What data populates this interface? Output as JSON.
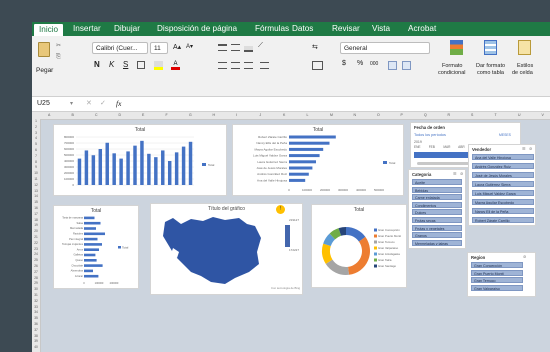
{
  "tabs": [
    "Inicio",
    "Insertar",
    "Dibujar",
    "Disposición de página",
    "Fórmulas",
    "Datos",
    "Revisar",
    "Vista",
    "Acrobat"
  ],
  "ribbon": {
    "paste_label": "Pegar",
    "font_name": "Calibri (Cuer...",
    "font_size": "11",
    "grow_font": "A▴",
    "shrink_font": "A▾",
    "bold": "N",
    "italic": "K",
    "underline": "S",
    "number_format": "General",
    "currency": "$",
    "percent": "%",
    "thousands": "000",
    "cond_format_1": "Formato",
    "cond_format_2": "condicional",
    "format_table_1": "Dar formato",
    "format_table_2": "como tabla",
    "cell_styles_1": "Estilos",
    "cell_styles_2": "de celda"
  },
  "formula_bar": {
    "name_box": "U25",
    "fx": "fx",
    "value": ""
  },
  "columns": [
    "A",
    "B",
    "C",
    "D",
    "E",
    "F",
    "G",
    "H",
    "I",
    "J",
    "K",
    "L",
    "M",
    "N",
    "O",
    "P",
    "Q",
    "R",
    "S",
    "T",
    "U",
    "V"
  ],
  "rows": [
    "1",
    "2",
    "3",
    "4",
    "5",
    "6",
    "7",
    "8",
    "9",
    "10",
    "11",
    "12",
    "13",
    "14",
    "15",
    "16",
    "17",
    "18",
    "19",
    "20",
    "21",
    "22",
    "23",
    "24",
    "25",
    "26",
    "27",
    "28",
    "29",
    "30",
    "31",
    "32",
    "33",
    "34",
    "35",
    "36",
    "37",
    "38",
    "39",
    "40"
  ],
  "chart1": {
    "title": "Total",
    "legend": "Total",
    "yticks": [
      "800000",
      "700000",
      "600000",
      "500000",
      "400000",
      "300000",
      "200000",
      "100000",
      "0"
    ],
    "values": [
      0.55,
      0.72,
      0.62,
      0.75,
      0.88,
      0.66,
      0.55,
      0.7,
      0.82,
      0.92,
      0.65,
      0.58,
      0.72,
      0.5,
      0.68,
      0.8,
      0.9
    ]
  },
  "chart2": {
    "title": "Total",
    "legend": "Total",
    "labels": [
      "Robert Zárate Carrillo",
      "Nancy Ellis del la Peña",
      "Mayra Aguilar Escobedo",
      "Luis Miguel Valdez Garza",
      "Laura Gutiérrez Sierra",
      "José de Jesús Morales",
      "Andrés González Ruiz",
      "Ana del Valle Hinojosa"
    ],
    "values": [
      0.52,
      0.45,
      0.38,
      0.34,
      0.3,
      0.26,
      0.22,
      0.18
    ],
    "xticks": [
      "0",
      "100000",
      "200000",
      "300000",
      "400000",
      "500000"
    ]
  },
  "slicer_fecha": {
    "title": "Fecha de orden",
    "sub": "Todos los períodos",
    "unit": "MESES",
    "year": "2019",
    "months": [
      "ENE",
      "FEB",
      "MAR",
      "ABR",
      "MAY",
      "JUN",
      "JUL"
    ]
  },
  "slicer_categoria": {
    "title": "Categoria",
    "items": [
      "Aceite",
      "Bebidas",
      "Carne enlatada",
      "Condimentos",
      "Dulces",
      "Frutas secas",
      "Frutas y vegetales",
      "Granos",
      "Mermeladas y jaleas"
    ]
  },
  "slicer_vendedor": {
    "title": "Vendedor",
    "items": [
      "Ana del Valle Hinojosa",
      "Andrés González Ruiz",
      "José de Jesús Morales",
      "Laura Gutiérrez Sierra",
      "Luis Miguel Valdez Garza",
      "Mayra Aguilar Escobedo",
      "Nancy Ell de la Peña",
      "Robert Zárate Carrillo"
    ]
  },
  "slicer_region": {
    "title": "Region",
    "items": [
      "Gran Concepción",
      "Gran Puerto Montt",
      "Gran Temuco",
      "Gran Valparaíso"
    ]
  },
  "chart3": {
    "title": "Total",
    "legend": "Total",
    "labels": [
      "Tarta de manzana",
      "Salsa",
      "Mermelada",
      "Ravioles",
      "Pan integral",
      "Torrejas crujientes",
      "Arroz",
      "Galletas",
      "Queso",
      "Chocolate",
      "Almendras",
      "Azúcar"
    ],
    "values": [
      0.35,
      0.55,
      0.4,
      0.7,
      0.45,
      0.6,
      0.5,
      0.38,
      0.42,
      0.62,
      0.3,
      0.48
    ],
    "xticks": [
      "0",
      "100000",
      "200000"
    ]
  },
  "map": {
    "title": "Título del gráfico",
    "scale_max": "219127",
    "scale_min": "172227",
    "footer": "Con tecnología de Bing"
  },
  "donut": {
    "title": "Total",
    "legend": [
      "Gran Concepción",
      "Gran Puerto Montt",
      "Gran Temuco",
      "Gran Valparaíso",
      "Gran Antofagasta",
      "Gran Talca",
      "Gran Santiago"
    ],
    "colors": [
      "#4472c4",
      "#ed7d31",
      "#a5a5a5",
      "#ffc000",
      "#5b9bd5",
      "#70ad47",
      "#264478"
    ]
  },
  "colors": {
    "excel_green": "#1f7a45",
    "bar_blue": "#4472c4",
    "map_blue": "#2f55a4",
    "slicer_item": "#9fb4d6"
  }
}
